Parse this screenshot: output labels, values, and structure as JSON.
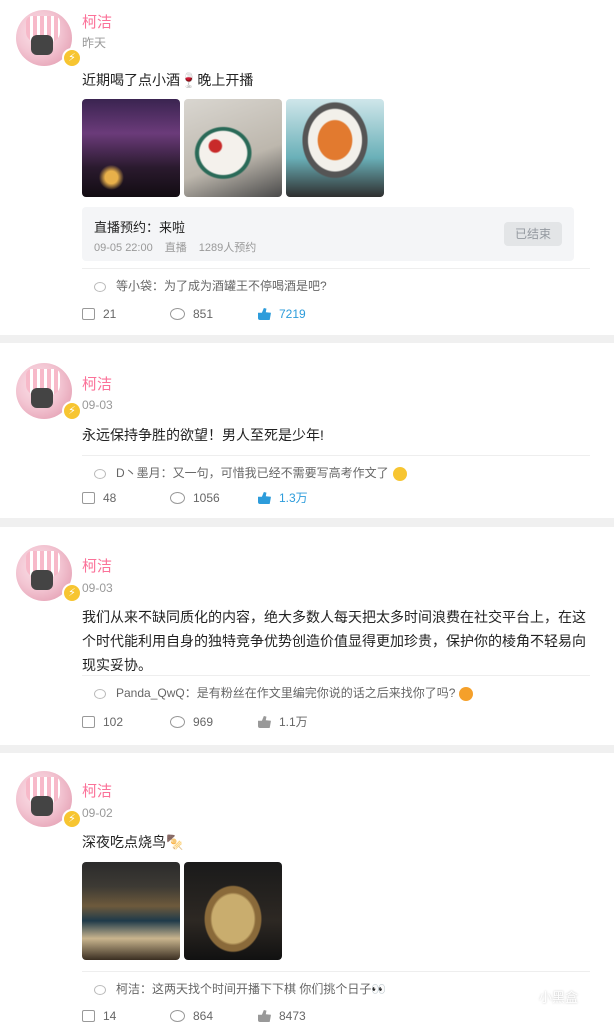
{
  "posts": [
    {
      "author": "柯洁",
      "date": "昨天",
      "text": "近期喝了点小酒🍷晚上开播",
      "live": {
        "title": "直播预约：来啦",
        "time": "09-05 22:00",
        "kind": "直播",
        "count": "1289人预约",
        "button": "已结束"
      },
      "comment": "等小袋：为了成为酒罐王不停喝酒是吧?",
      "shares": "21",
      "comments": "851",
      "likes": "7219",
      "liked": true
    },
    {
      "author": "柯洁",
      "date": "09-03",
      "text": "永远保持争胜的欲望！男人至死是少年!",
      "comment": "D丶墨月：又一句，可惜我已经不需要写高考作文了",
      "comment_emoji": "smile-emoji",
      "shares": "48",
      "comments": "1056",
      "likes": "1.3万",
      "liked": true
    },
    {
      "author": "柯洁",
      "date": "09-03",
      "text_lines": [
        "我们从来不缺同质化的内容，绝大多数人每天把太多时间浪费在社交平台上，在这",
        "个时代能利用自身的独特竞争优势创造价值显得更加珍贵，保护你的棱角不轻易向",
        "现实妥协。"
      ],
      "comment": "Panda_QwQ：是有粉丝在作文里编完你说的话之后来找你了吗?",
      "comment_emoji": "laugh-emoji",
      "shares": "102",
      "comments": "969",
      "likes": "1.1万",
      "liked": false
    },
    {
      "author": "柯洁",
      "date": "09-02",
      "text": "深夜吃点烧鸟🍢",
      "comment": "柯洁：这两天找个时间开播下下棋 你们挑个日子👀",
      "shares": "14",
      "comments": "864",
      "likes": "8473",
      "liked": false
    }
  ],
  "watermark": "小黑盒",
  "colors": {
    "name": "#fb7299",
    "liked": "#2d9cdb",
    "background": "#f0f0f0"
  }
}
